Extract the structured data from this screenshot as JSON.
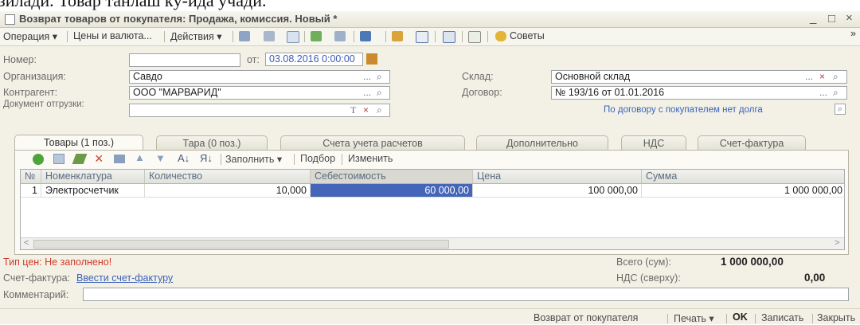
{
  "caption_fragment": "зилади. Товар танлаш кў-ида учади.",
  "window": {
    "title": "Возврат товаров от покупателя: Продажа, комиссия. Новый *",
    "min": "_",
    "max": "□",
    "close": "×"
  },
  "toolbar": {
    "operation": "Операция ▾",
    "prices": "Цены и валюта...",
    "actions": "Действия ▾",
    "tips": "Советы",
    "overflow": "»"
  },
  "header": {
    "number_label": "Номер:",
    "number_value": "",
    "date_label": "от:",
    "date_value": "03.08.2016  0:00:00",
    "org_label": "Организация:",
    "org_value": "Савдо",
    "counterparty_label": "Контрагент:",
    "counterparty_value": "ООО \"МАРВАРИД\"",
    "shipment_label": "Документ отгрузки:",
    "shipment_value": "",
    "warehouse_label": "Склад:",
    "warehouse_value": "Основной склад",
    "contract_label": "Договор:",
    "contract_value": "№ 193/16 от 01.01.2016",
    "debt_note": "По договору с покупателем нет долга"
  },
  "tabs": [
    {
      "label": "Товары (1 поз.)",
      "active": true
    },
    {
      "label": "Тара (0 поз.)",
      "active": false
    },
    {
      "label": "Счета учета расчетов",
      "active": false
    },
    {
      "label": "Дополнительно",
      "active": false
    },
    {
      "label": "НДС",
      "active": false
    },
    {
      "label": "Счет-фактура",
      "active": false
    }
  ],
  "table_toolbar": {
    "fill": "Заполнить ▾",
    "select": "Подбор",
    "change": "Изменить"
  },
  "table": {
    "columns": [
      "№",
      "Номенклатура",
      "Количество",
      "Себестоимость",
      "Цена",
      "Сумма"
    ],
    "rows": [
      {
        "n": "1",
        "item": "Электросчетчик",
        "qty": "10,000",
        "cost": "60 000,00",
        "price": "100 000,00",
        "sum": "1 000 000,00"
      }
    ]
  },
  "footer": {
    "price_type": "Тип цен: Не заполнено!",
    "total_label": "Всего (сум):",
    "total_value": "1 000 000,00",
    "invoice_label": "Счет-фактура:",
    "invoice_link": "Ввести счет-фактуру",
    "vat_label": "НДС (сверху):",
    "vat_value": "0,00",
    "comment_label": "Комментарий:",
    "comment_value": ""
  },
  "statusbar": {
    "return": "Возврат от покупателя",
    "print": "Печать ▾",
    "ok": "OK",
    "save": "Записать",
    "close": "Закрыть"
  },
  "colors": {
    "accent_blue": "#3b5bb5",
    "selected_cell": "#4566b8",
    "warning_red": "#d23a2a",
    "link_blue": "#3a62b8"
  }
}
